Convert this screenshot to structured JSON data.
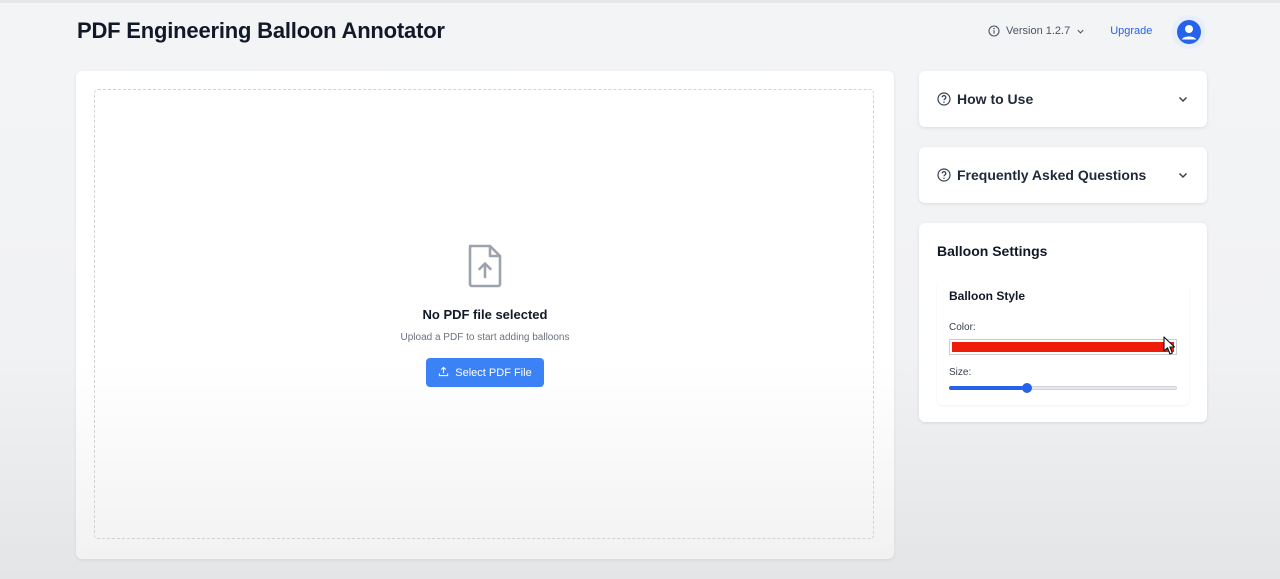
{
  "header": {
    "title": "PDF Engineering Balloon Annotator",
    "version": "Version 1.2.7",
    "upgrade": "Upgrade"
  },
  "upload": {
    "empty_title": "No PDF file selected",
    "hint": "Upload a PDF to start adding balloons",
    "button_label": "Select PDF File"
  },
  "sidebar": {
    "how_to_use": "How to Use",
    "faq": "Frequently Asked Questions",
    "settings": {
      "title": "Balloon Settings",
      "style_title": "Balloon Style",
      "color_label": "Color:",
      "color_value": "#ef1c0a",
      "size_label": "Size:",
      "size_fraction": 0.34
    }
  },
  "colors": {
    "accent": "#3b82f6",
    "link": "#2563eb"
  },
  "icons": [
    "info-icon",
    "chevron-down-icon",
    "user-icon",
    "file-upload-icon",
    "upload-icon",
    "help-circle-icon",
    "mouse-cursor-icon"
  ]
}
